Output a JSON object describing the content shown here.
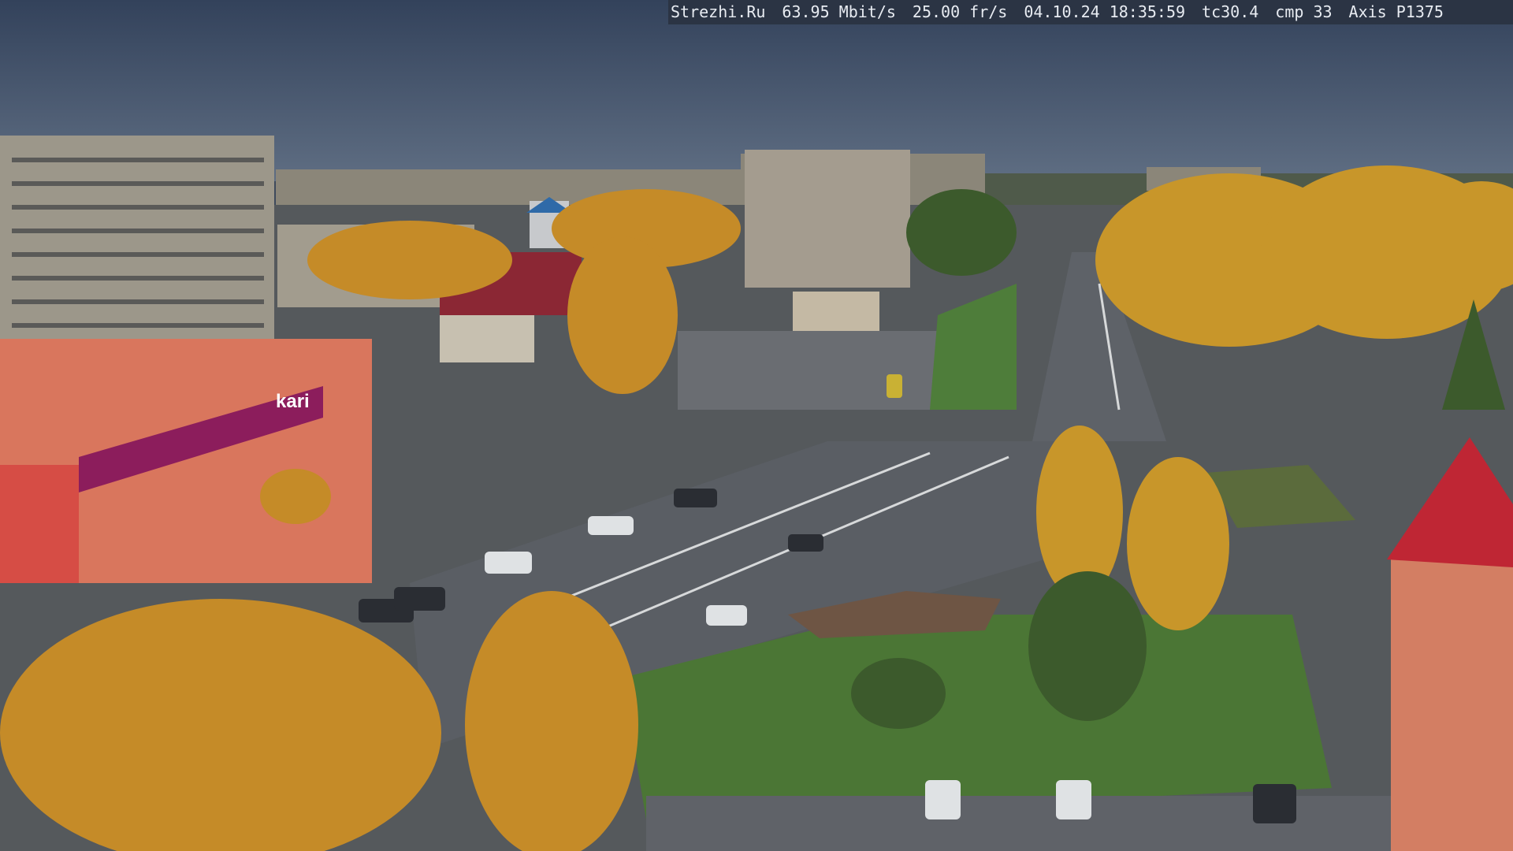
{
  "overlay": {
    "site": "Strezhi.Ru",
    "bitrate": "63.95 Mbit/s",
    "framerate": "25.00 fr/s",
    "datetime": "04.10.24 18:35:59",
    "tc": "tc30.4",
    "cmp": "cmp 33",
    "camera": "Axis P1375"
  },
  "signs": {
    "store_logo": "kari"
  },
  "colors": {
    "sky": "#3f4e66",
    "asphalt": "#5c6168",
    "grass": "#4d7a37",
    "foliage": "#c8962a",
    "store_sign": "#8c1d5c"
  }
}
